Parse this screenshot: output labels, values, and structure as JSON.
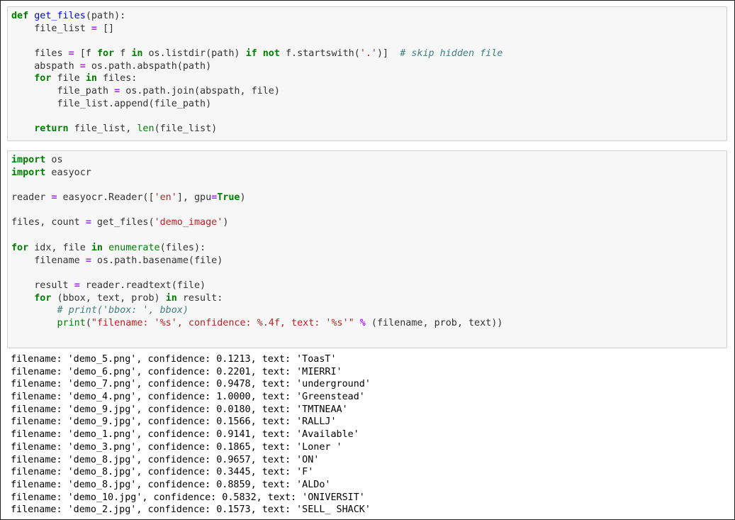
{
  "cells": [
    {
      "name": "get-files-code-cell",
      "lines": [
        [
          [
            "k",
            "def"
          ],
          [
            "t",
            " "
          ],
          [
            "f",
            "get_files"
          ],
          [
            "t",
            "(path):"
          ]
        ],
        [
          [
            "t",
            "    file_list "
          ],
          [
            "o",
            "="
          ],
          [
            "t",
            " []"
          ]
        ],
        [],
        [
          [
            "t",
            "    files "
          ],
          [
            "o",
            "="
          ],
          [
            "t",
            " [f "
          ],
          [
            "k",
            "for"
          ],
          [
            "t",
            " f "
          ],
          [
            "k",
            "in"
          ],
          [
            "t",
            " os.listdir(path) "
          ],
          [
            "k",
            "if"
          ],
          [
            "t",
            " "
          ],
          [
            "k",
            "not"
          ],
          [
            "t",
            " f.startswith("
          ],
          [
            "s",
            "'.'"
          ],
          [
            "t",
            ")]  "
          ],
          [
            "c",
            "# skip hidden file"
          ]
        ],
        [
          [
            "t",
            "    abspath "
          ],
          [
            "o",
            "="
          ],
          [
            "t",
            " os.path.abspath(path)"
          ]
        ],
        [
          [
            "t",
            "    "
          ],
          [
            "k",
            "for"
          ],
          [
            "t",
            " file "
          ],
          [
            "k",
            "in"
          ],
          [
            "t",
            " files:"
          ]
        ],
        [
          [
            "t",
            "        file_path "
          ],
          [
            "o",
            "="
          ],
          [
            "t",
            " os.path.join(abspath, file)"
          ]
        ],
        [
          [
            "t",
            "        file_list.append(file_path)"
          ]
        ],
        [],
        [
          [
            "t",
            "    "
          ],
          [
            "k",
            "return"
          ],
          [
            "t",
            " file_list, "
          ],
          [
            "b",
            "len"
          ],
          [
            "t",
            "(file_list)"
          ]
        ]
      ]
    },
    {
      "name": "easyocr-code-cell",
      "lines": [
        [
          [
            "k",
            "import"
          ],
          [
            "t",
            " os"
          ]
        ],
        [
          [
            "k",
            "import"
          ],
          [
            "t",
            " easyocr"
          ]
        ],
        [],
        [
          [
            "t",
            "reader "
          ],
          [
            "o",
            "="
          ],
          [
            "t",
            " easyocr.Reader(["
          ],
          [
            "s",
            "'en'"
          ],
          [
            "t",
            "], gpu"
          ],
          [
            "o",
            "="
          ],
          [
            "k",
            "True"
          ],
          [
            "t",
            ")"
          ]
        ],
        [],
        [
          [
            "t",
            "files, count "
          ],
          [
            "o",
            "="
          ],
          [
            "t",
            " get_files("
          ],
          [
            "s",
            "'demo_image'"
          ],
          [
            "t",
            ")"
          ]
        ],
        [],
        [
          [
            "k",
            "for"
          ],
          [
            "t",
            " idx, file "
          ],
          [
            "k",
            "in"
          ],
          [
            "t",
            " "
          ],
          [
            "b",
            "enumerate"
          ],
          [
            "t",
            "(files):"
          ]
        ],
        [
          [
            "t",
            "    filename "
          ],
          [
            "o",
            "="
          ],
          [
            "t",
            " os.path.basename(file)"
          ]
        ],
        [],
        [
          [
            "t",
            "    result "
          ],
          [
            "o",
            "="
          ],
          [
            "t",
            " reader.readtext(file)"
          ]
        ],
        [
          [
            "t",
            "    "
          ],
          [
            "k",
            "for"
          ],
          [
            "t",
            " (bbox, text, prob) "
          ],
          [
            "k",
            "in"
          ],
          [
            "t",
            " result:"
          ]
        ],
        [
          [
            "t",
            "        "
          ],
          [
            "c",
            "# print('bbox: ', bbox)"
          ]
        ],
        [
          [
            "t",
            "        "
          ],
          [
            "b",
            "print"
          ],
          [
            "t",
            "("
          ],
          [
            "s",
            "\"filename: '%s', confidence: %.4f, text: '%s'\""
          ],
          [
            "t",
            " "
          ],
          [
            "o",
            "%"
          ],
          [
            "t",
            " (filename, prob, text))"
          ]
        ]
      ]
    }
  ],
  "output": {
    "lines": [
      "filename: 'demo_5.png', confidence: 0.1213, text: 'ToasT'",
      "filename: 'demo_6.png', confidence: 0.2201, text: 'MIERRI'",
      "filename: 'demo_7.png', confidence: 0.9478, text: 'underground'",
      "filename: 'demo_4.png', confidence: 1.0000, text: 'Greenstead'",
      "filename: 'demo_9.jpg', confidence: 0.0180, text: 'TMTNEAA'",
      "filename: 'demo_9.jpg', confidence: 0.1566, text: 'RALLJ'",
      "filename: 'demo_1.png', confidence: 0.9141, text: 'Available'",
      "filename: 'demo_3.png', confidence: 0.1865, text: 'Loner '",
      "filename: 'demo_8.jpg', confidence: 0.9657, text: 'ON'",
      "filename: 'demo_8.jpg', confidence: 0.3445, text: 'F'",
      "filename: 'demo_8.jpg', confidence: 0.8859, text: 'ALDo'",
      "filename: 'demo_10.jpg', confidence: 0.5832, text: 'ONIVERSIT'",
      "filename: 'demo_2.jpg', confidence: 0.1573, text: 'SELL_ SHACK'"
    ]
  },
  "colors": {
    "keyword": "#008000",
    "function_name": "#0000ff",
    "builtin": "#008000",
    "operator": "#aa22ff",
    "string": "#ba2121",
    "comment": "#408080",
    "cell_background": "#f7f7f7",
    "cell_border": "#cfcfcf"
  }
}
